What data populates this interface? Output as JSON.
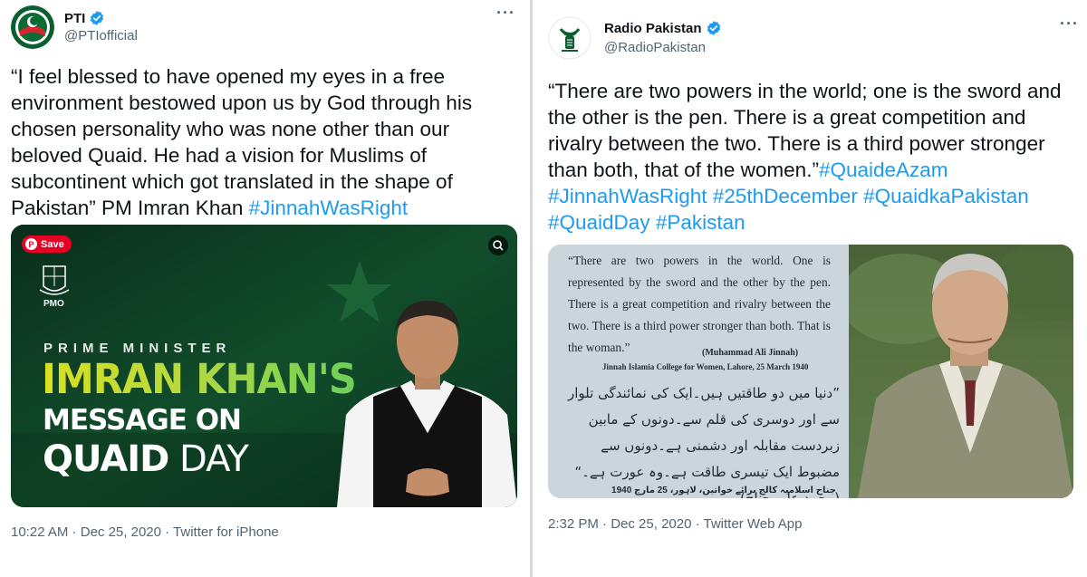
{
  "tweets": [
    {
      "account_name": "PTI",
      "handle": "@PTIofficial",
      "text": "“I feel blessed to have opened my eyes in a free environment bestowed upon us by God through his chosen personality who was none other than our beloved Quaid. He had a vision for Muslims of subcontinent which got translated in the shape of Pakistan” PM Imran Khan ",
      "hashtags": [
        "#JinnahWasRight"
      ],
      "media": {
        "save_label": "Save",
        "pmo_label": "PMO",
        "line1": "PRIME MINISTER",
        "line2": "IMRAN KHAN'S",
        "line3": "MESSAGE ON",
        "line4_bold": "QUAID",
        "line4_light": "DAY"
      },
      "time": "10:22 AM",
      "date": "Dec 25, 2020",
      "source": "Twitter for iPhone"
    },
    {
      "account_name": "Radio Pakistan",
      "handle": "@RadioPakistan",
      "text": "“There are two powers in the world; one is the sword and the other is the pen. There is a great competition and rivalry between the two. There is a third power stronger than both, that of the women.”",
      "hashtags": [
        "#QuaideAzam",
        "#JinnahWasRight",
        "#25thDecember",
        "#QuaidkaPakistan",
        "#QuaidDay",
        "#Pakistan"
      ],
      "media": {
        "english_quote": "“There are two powers in the world. One is represented by the sword and the other by the pen. There is a great competition and rivalry between the two. There is a third power stronger than both. That is the woman.”",
        "attribution": "(Muhammad Ali Jinnah)",
        "attribution_place": "Jinnah Islamia College for Women, Lahore, 25 March 1940",
        "urdu_quote": "”دنیا میں دو طاقتیں ہیں۔ایک کی نمائندگی تلوار سے اور دوسری کی قلم سے۔دونوں کے مابین زبردست مقابلہ اور دشمنی ہے۔دونوں سے مضبوط ایک تیسری طاقت ہے۔وہ عورت ہے۔“ (محمد علی جناح)",
        "urdu_attribution": "جناح اسلامیہ کالج برائے خواتین، لاہور، 25 مارچ 1940"
      },
      "time": "2:32 PM",
      "date": "Dec 25, 2020",
      "source": "Twitter Web App"
    }
  ],
  "colors": {
    "link": "#1d9bf0",
    "muted": "#536471",
    "verified": "#1d9bf0",
    "pinterest": "#e60023"
  },
  "icons": [
    "verified-badge-icon",
    "more-options-icon",
    "pinterest-icon",
    "visual-search-icon"
  ]
}
